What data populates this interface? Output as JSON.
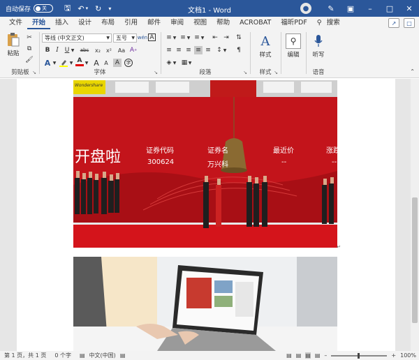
{
  "titlebar": {
    "autosave_label": "自动保存",
    "autosave_state": "关",
    "doc_title": "文档1 - Word",
    "save_icon": "save-icon",
    "undo_icon": "undo-icon",
    "redo_icon": "redo-icon",
    "user_icon": "user-avatar-icon"
  },
  "menu": {
    "tabs": [
      "文件",
      "开始",
      "插入",
      "设计",
      "布局",
      "引用",
      "邮件",
      "审阅",
      "视图",
      "帮助",
      "ACROBAT",
      "福昕PDF",
      "搜索"
    ]
  },
  "ribbon": {
    "clipboard": {
      "paste_label": "粘贴",
      "group_label": "剪贴板"
    },
    "font": {
      "font_name": "等线 (中文正文)",
      "font_size": "五号",
      "group_label": "字体",
      "bold": "B",
      "italic": "I",
      "underline": "U",
      "strike": "abc",
      "subscript": "x₂",
      "superscript": "x²",
      "clear_format": "A",
      "text_effect": "A",
      "highlight": "ab",
      "font_color": "A",
      "grow": "A",
      "shrink": "A",
      "case": "Aa",
      "pinyin": "wén",
      "border_char": "A",
      "shading_char": "A",
      "enclose_char": "字"
    },
    "paragraph": {
      "group_label": "段落"
    },
    "styles": {
      "button_label": "样式",
      "group_label": "样式"
    },
    "editing": {
      "button_label": "编辑"
    },
    "voice": {
      "button_label": "听写",
      "group_label": "语音"
    }
  },
  "photo1": {
    "sponsor": "Wondershare",
    "headline": "开盘啦",
    "col1_title": "证券代码",
    "col1_value": "300624",
    "col2_title": "证券名",
    "col2_value": "万兴科",
    "col3_title": "最近价",
    "col3_value": "--",
    "col4_title": "涨跌",
    "col4_value": "--"
  },
  "status": {
    "page": "第 1 页，共 1 页",
    "words": "0 个字",
    "lang": "中文(中国)",
    "zoom": "100%"
  }
}
